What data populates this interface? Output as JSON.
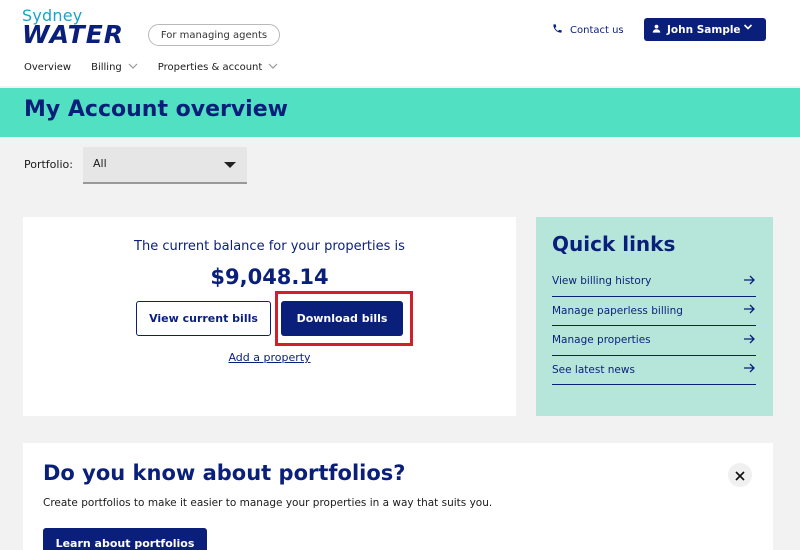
{
  "header": {
    "logo_top": "Sydney",
    "logo_bottom": "WATER",
    "audience_pill": "For managing agents",
    "contact_label": "Contact us",
    "user_name": "John Sample"
  },
  "nav": {
    "items": [
      {
        "label": "Overview",
        "has_dropdown": false
      },
      {
        "label": "Billing",
        "has_dropdown": true
      },
      {
        "label": "Properties & account",
        "has_dropdown": true
      }
    ]
  },
  "page": {
    "title": "My Account overview"
  },
  "portfolio": {
    "label": "Portfolio:",
    "selected": "All"
  },
  "balance": {
    "text": "The current balance for your properties is",
    "amount": "$9,048.14",
    "view_bills_label": "View current bills",
    "download_bills_label": "Download bills",
    "add_property_label": "Add a property"
  },
  "quick_links": {
    "title": "Quick links",
    "items": [
      {
        "label": "View billing history"
      },
      {
        "label": "Manage paperless billing"
      },
      {
        "label": "Manage properties"
      },
      {
        "label": "See latest news"
      }
    ]
  },
  "portfolios_banner": {
    "title": "Do you know about portfolios?",
    "description": "Create portfolios to make it easier to manage your properties in a way that suits you.",
    "button_label": "Learn about portfolios"
  },
  "colors": {
    "brand_navy": "#0a1f7a",
    "brand_teal": "#52e0c2",
    "quick_links_bg": "#b6e6da",
    "highlight_red": "#d0202a"
  }
}
